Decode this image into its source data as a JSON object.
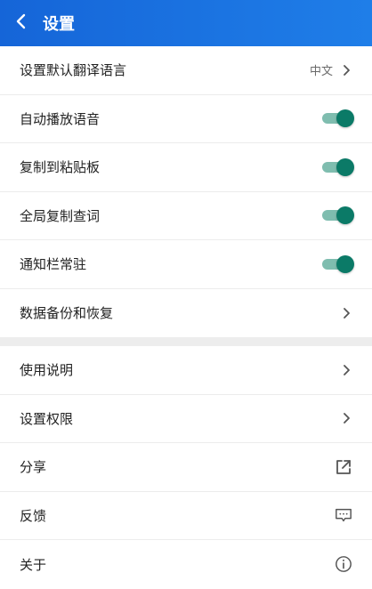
{
  "header": {
    "title": "设置"
  },
  "colors": {
    "header_start": "#1565d8",
    "header_end": "#1f7ee8",
    "toggle_on_thumb": "#0b7a67",
    "toggle_on_track": "#7fbdaf",
    "divider_band": "#ededed"
  },
  "settings": {
    "default_language": {
      "label": "设置默认翻译语言",
      "value": "中文",
      "icon": "chevron-right-icon"
    },
    "auto_play_voice": {
      "label": "自动播放语音",
      "on": true
    },
    "copy_to_clipboard": {
      "label": "复制到粘贴板",
      "on": true
    },
    "global_copy_lookup": {
      "label": "全局复制查词",
      "on": true
    },
    "notification_pinned": {
      "label": "通知栏常驻",
      "on": true
    },
    "backup_restore": {
      "label": "数据备份和恢复",
      "icon": "chevron-right-icon"
    }
  },
  "more": {
    "usage": {
      "label": "使用说明",
      "icon": "chevron-right-icon"
    },
    "permissions": {
      "label": "设置权限",
      "icon": "chevron-right-icon"
    },
    "share": {
      "label": "分享",
      "icon": "external-link-icon"
    },
    "feedback": {
      "label": "反馈",
      "icon": "message-icon"
    },
    "about": {
      "label": "关于",
      "icon": "info-icon"
    }
  }
}
